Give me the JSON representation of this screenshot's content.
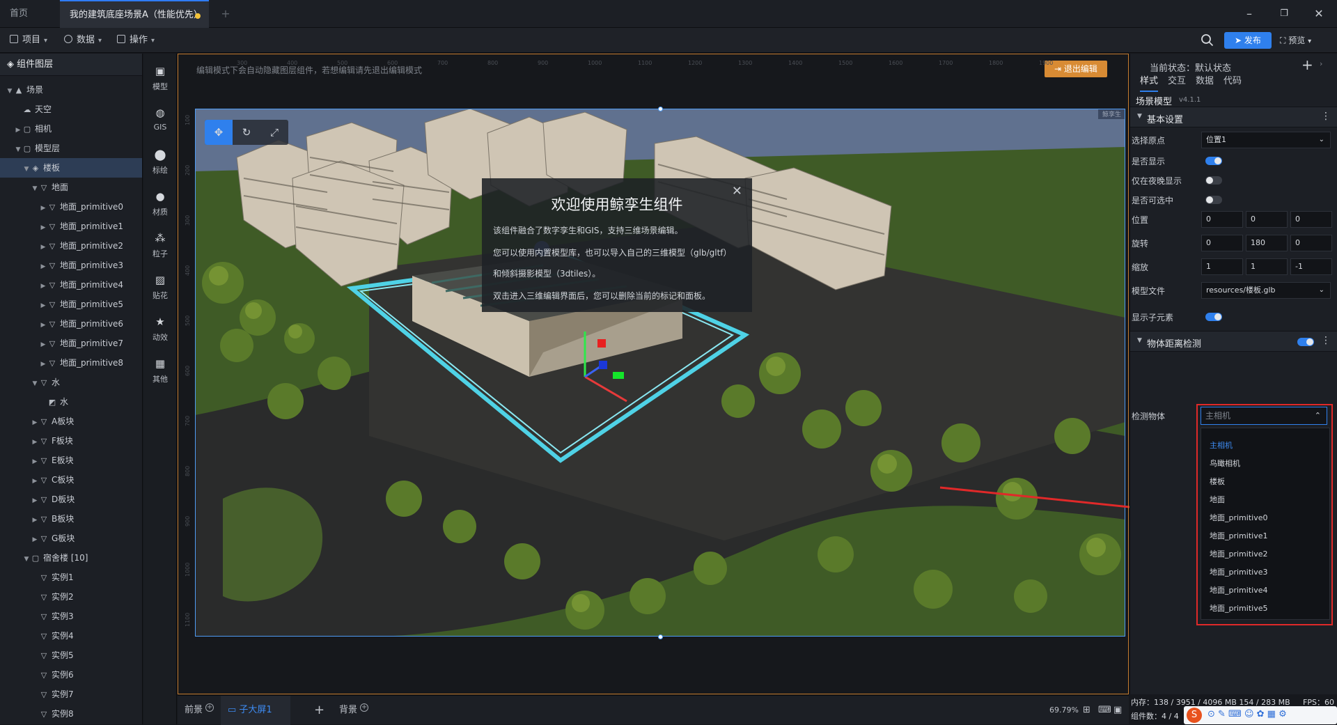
{
  "tabs": [
    {
      "label": "首页"
    },
    {
      "label": "我的建筑底座场景A（性能优先）"
    }
  ],
  "toolbar": {
    "menus": [
      "项目",
      "数据",
      "操作"
    ],
    "publish": "发布",
    "preview": "预览"
  },
  "layers": {
    "title": "组件图层",
    "items": [
      "场景",
      "天空",
      "相机",
      "模型层",
      "楼板",
      "地面",
      "地面_primitive0",
      "地面_primitive1",
      "地面_primitive2",
      "地面_primitive3",
      "地面_primitive4",
      "地面_primitive5",
      "地面_primitive6",
      "地面_primitive7",
      "地面_primitive8",
      "水",
      "水",
      "A板块",
      "F板块",
      "E板块",
      "C板块",
      "D板块",
      "B板块",
      "G板块",
      "宿舍楼 [10]",
      "实例1",
      "实例2",
      "实例3",
      "实例4",
      "实例5",
      "实例6",
      "实例7",
      "实例8"
    ]
  },
  "components": [
    "模型",
    "GIS",
    "标绘",
    "材质",
    "粒子",
    "贴花",
    "动效",
    "其他"
  ],
  "canvas": {
    "notice": "编辑模式下会自动隐藏图层组件，若想编辑请先退出编辑模式",
    "exit_edit": "退出编辑",
    "scene_label": "鲸孪生",
    "ruler_h": [
      "300",
      "400",
      "500",
      "600",
      "700",
      "800",
      "900",
      "1000",
      "1100",
      "1200",
      "1300",
      "1400",
      "1500",
      "1600",
      "1700",
      "1800",
      "1900"
    ],
    "ruler_v": [
      "100",
      "200",
      "300",
      "400",
      "500",
      "600",
      "700",
      "800",
      "900",
      "1000",
      "1100"
    ]
  },
  "welcome": {
    "title": "欢迎使用鲸孪生组件",
    "lines": [
      "该组件融合了数字孪生和GIS，支持三维场景编辑。",
      "您可以使用内置模型库，也可以导入自己的三维模型（glb/gltf）",
      "和倾斜摄影模型（3dtiles）。",
      "双击进入三维编辑界面后，您可以删除当前的标记和面板。"
    ]
  },
  "bottom": {
    "front": "前景",
    "sub_screen": "子大屏1",
    "background": "背景",
    "zoom": "69.79%"
  },
  "props": {
    "state": "当前状态：默认状态",
    "tabs": [
      "样式",
      "交互",
      "数据",
      "代码"
    ],
    "component_name": "场景模型",
    "version": "v4.1.1",
    "section_basic": "基本设置",
    "origin_label": "选择原点",
    "origin_value": "位置1",
    "visible_label": "是否显示",
    "night_label": "仅在夜晚显示",
    "selectable_label": "是否可选中",
    "position_label": "位置",
    "position": [
      "0",
      "0",
      "0"
    ],
    "rotation_label": "旋转",
    "rotation": [
      "0",
      "180",
      "0"
    ],
    "scale_label": "缩放",
    "scale": [
      "1",
      "1",
      "-1"
    ],
    "model_file_label": "模型文件",
    "model_file": "resources/楼板.glb",
    "show_children_label": "显示子元素",
    "section_distance": "物体距离检测",
    "detect_label": "检测物体",
    "detect_value": "主相机",
    "dropdown": [
      "主相机",
      "鸟瞰相机",
      "楼板",
      "地面",
      "地面_primitive0",
      "地面_primitive1",
      "地面_primitive2",
      "地面_primitive3",
      "地面_primitive4",
      "地面_primitive5"
    ]
  },
  "status": {
    "memory": "内存：138 / 3951 / 4096 MB 154 / 283 MB",
    "fps": "FPS：60",
    "components": "组件数：4 / 4"
  },
  "colors": {
    "accent": "#2f80ed",
    "edit_frame": "#c47a2c",
    "exit_button": "#d88b34",
    "highlight_box": "#e02929"
  }
}
